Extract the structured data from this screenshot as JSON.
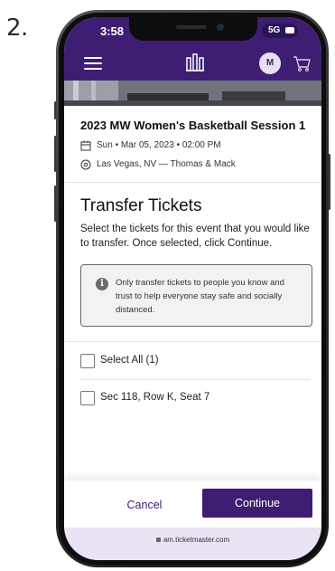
{
  "step_number": "2.",
  "status_bar": {
    "time": "3:58",
    "network": "5G"
  },
  "nav": {
    "avatar_initial": "M"
  },
  "event": {
    "title": "2023 MW Women's Basketball Session 1",
    "datetime": "Sun • Mar 05, 2023 • 02:00 PM",
    "location": "Las Vegas, NV — Thomas & Mack"
  },
  "transfer": {
    "heading": "Transfer Tickets",
    "instructions": "Select the tickets for this event that you would like to transfer. Once selected, click Continue.",
    "notice": "Only transfer tickets to people you know and trust to help everyone stay safe and socially distanced.",
    "select_all_label": "Select All (1)",
    "tickets": [
      {
        "label": "Sec 118, Row K, Seat 7",
        "checked": false
      }
    ]
  },
  "footer": {
    "cancel_label": "Cancel",
    "continue_label": "Continue"
  },
  "browser": {
    "url": "am.ticketmaster.com"
  },
  "colors": {
    "brand_purple": "#3d1e73",
    "url_bar": "#ebe3f3"
  }
}
